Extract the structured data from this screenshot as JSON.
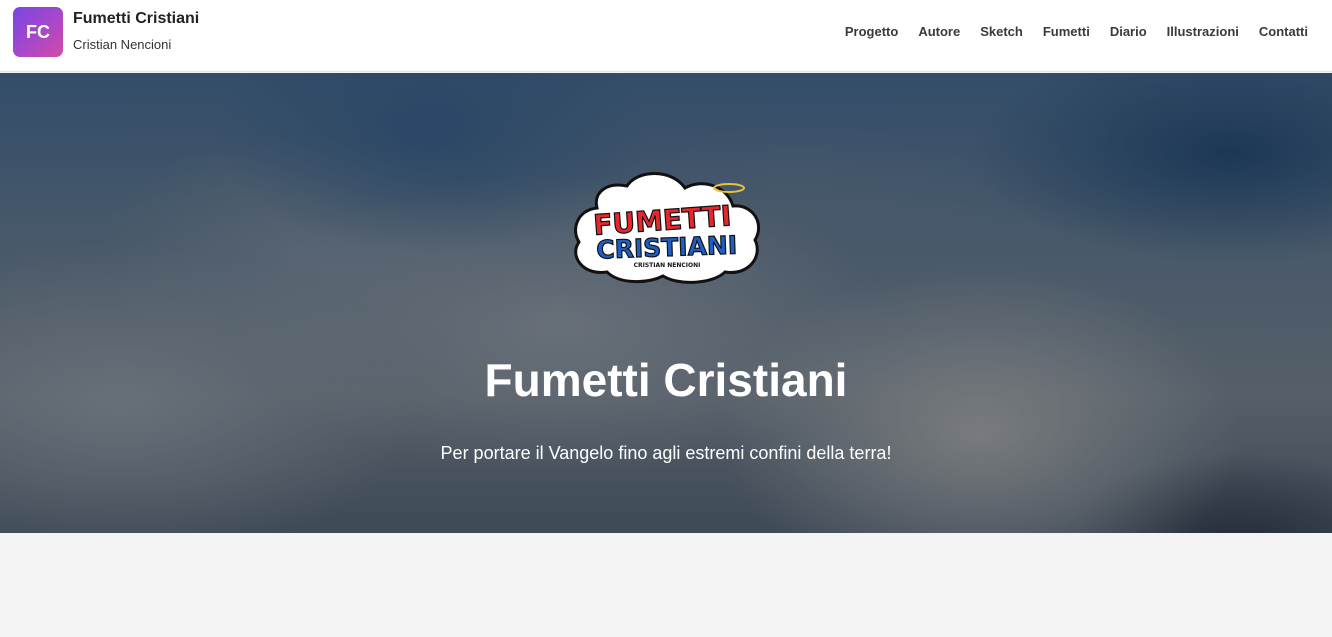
{
  "header": {
    "logo_initials": "FC",
    "brand_title": "Fumetti Cristiani",
    "brand_subtitle": "Cristian Nencioni",
    "nav": [
      {
        "label": "Progetto"
      },
      {
        "label": "Autore"
      },
      {
        "label": "Sketch"
      },
      {
        "label": "Fumetti"
      },
      {
        "label": "Diario"
      },
      {
        "label": "Illustrazioni"
      },
      {
        "label": "Contatti"
      }
    ]
  },
  "hero": {
    "logo": {
      "line1": "FUMETTI",
      "line2": "CRISTIANI",
      "line3": "CRISTIAN NENCIONI"
    },
    "title": "Fumetti Cristiani",
    "subtitle": "Per portare il Vangelo fino agli estremi confini della terra!"
  },
  "colors": {
    "accent_gradient_start": "#7a45e3",
    "accent_gradient_end": "#d44aa5",
    "logo_red": "#e8262d",
    "logo_blue": "#1f5fc4"
  }
}
